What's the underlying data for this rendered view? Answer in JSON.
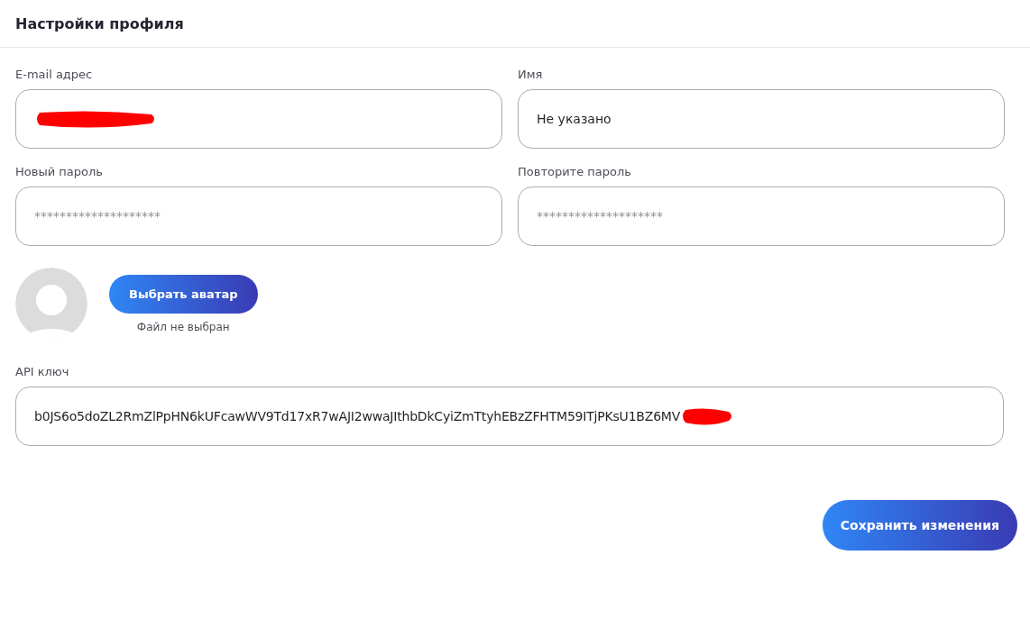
{
  "header": {
    "title": "Настройки профиля"
  },
  "fields": [
    {
      "label": "E-mail адрес",
      "kind": "redacted"
    },
    {
      "label": "Имя",
      "kind": "text",
      "value": "Не указано"
    },
    {
      "label": "Новый пароль",
      "kind": "password",
      "placeholder": "********************"
    },
    {
      "label": "Повторите пароль",
      "kind": "password",
      "placeholder": "********************"
    }
  ],
  "avatar": {
    "button": "Выбрать аватар",
    "file_status": "Файл не выбран"
  },
  "api_key": {
    "label": "API ключ",
    "value": "b0JS6o5doZL2RmZlPpHN6kUFcawWV9Td17xR7wAJI2wwaJIthbDkCyiZmTtyhEBzZFHTM59ITjPKsU1BZ6MV",
    "redacted_tail": true
  },
  "save_button": "Сохранить изменения"
}
